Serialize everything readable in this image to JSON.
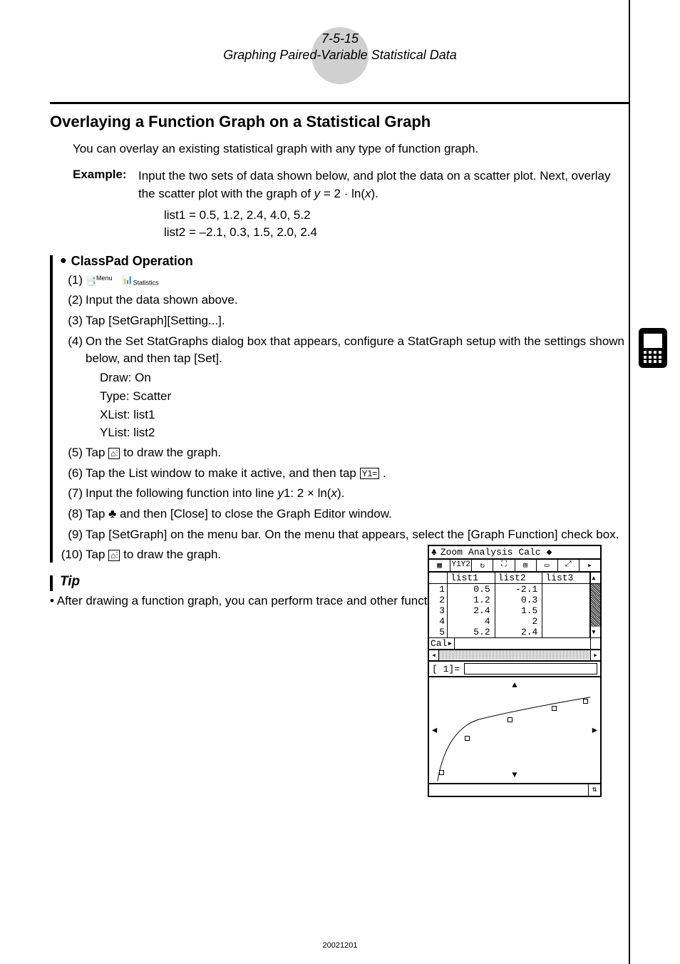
{
  "header": {
    "num": "7-5-15",
    "title": "Graphing Paired-Variable Statistical Data"
  },
  "h2": "Overlaying a Function Graph on a Statistical Graph",
  "intro": "You can overlay an existing statistical graph with any type of function graph.",
  "example": {
    "label": "Example:",
    "line1": "Input the two sets of data shown below, and plot the data on a scatter plot. Next, overlay the scatter plot with the graph of ",
    "func_prefix": "y",
    "func_mid": " = 2 · ln(",
    "func_var": "x",
    "func_suffix": ")."
  },
  "lists": {
    "l1": "list1 = 0.5,  1.2,  2.4,  4.0,  5.2",
    "l2": "list2 = –2.1,  0.3,  1.5,  2.0,  2.4"
  },
  "op_title": "ClassPad Operation",
  "menu_label": "Menu",
  "stats_label": "Statistics",
  "steps": {
    "s1_num": "(1)",
    "s2_num": "(2)",
    "s2": "Input the data shown above.",
    "s3_num": "(3)",
    "s3": "Tap [SetGraph][Setting...].",
    "s4_num": "(4)",
    "s4": "On the Set StatGraphs dialog box that appears, configure a StatGraph setup with the settings shown below, and then tap [Set].",
    "s5_num": "(5)",
    "s5a": "Tap ",
    "s5b": " to draw the graph.",
    "s6_num": "(6)",
    "s6a": "Tap the List window to make it active, and then tap ",
    "s6b": ".",
    "s7_num": "(7)",
    "s7a": "Input the following function into line ",
    "s7y": "y",
    "s7b": "1: 2 × ln(",
    "s7x": "x",
    "s7c": ").",
    "s8_num": "(8)",
    "s8a": "Tap ",
    "s8b": " and then [Close] to close the Graph Editor window.",
    "s9_num": "(9)",
    "s9": "Tap [SetGraph] on the menu bar. On the menu that appears, select the [Graph Function] check box.",
    "s10_num": "(10)",
    "s10a": "Tap ",
    "s10b": " to draw the graph."
  },
  "settings": {
    "draw": "Draw: On",
    "type": "Type: Scatter",
    "xlist": "XList: list1",
    "ylist": "YList: list2"
  },
  "tip": {
    "title": "Tip",
    "body": "After drawing a function graph, you can perform trace and other functions."
  },
  "footer_id": "20021201",
  "calc": {
    "menu": {
      "zoom": "Zoom",
      "analysis": "Analysis",
      "calc": "Calc"
    },
    "listhdr": {
      "l1": "list1",
      "l2": "list2",
      "l3": "list3"
    },
    "rows": [
      {
        "n": "1",
        "a": "0.5",
        "b": "-2.1"
      },
      {
        "n": "2",
        "a": "1.2",
        "b": "0.3"
      },
      {
        "n": "3",
        "a": "2.4",
        "b": "1.5"
      },
      {
        "n": "4",
        "a": "4",
        "b": "2"
      },
      {
        "n": "5",
        "a": "5.2",
        "b": "2.4"
      }
    ],
    "cal_label": "Cal▸",
    "input_label": "[ 1]=",
    "toolbar_icons": [
      "▦",
      "Y1Y2",
      "↻",
      "⛶",
      "⊞",
      "▭",
      "⤢",
      "▸"
    ]
  }
}
